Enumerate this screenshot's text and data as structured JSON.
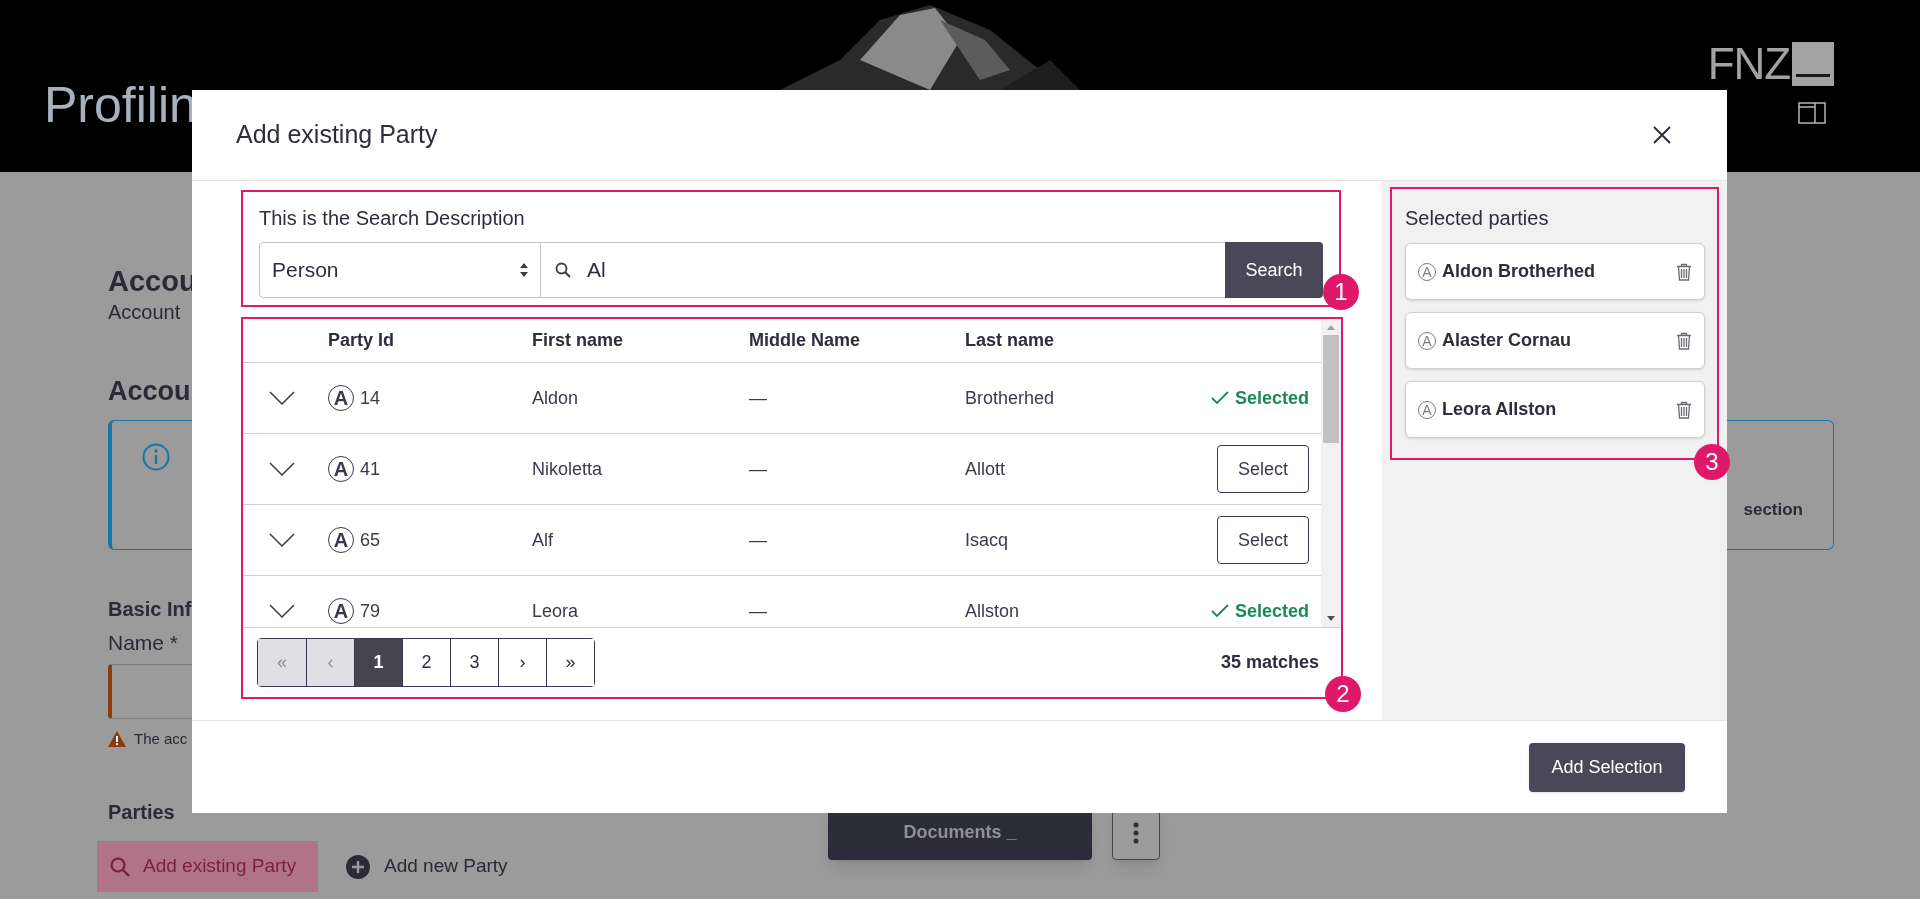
{
  "header": {
    "title": "Profilin",
    "logo": "FNZ"
  },
  "page": {
    "heading": "Accou",
    "subtitle": "Account",
    "section_heading": "Accou",
    "info_tail": "section",
    "basic_heading": "Basic Inf",
    "name_label": "Name *",
    "warning": "The acc",
    "parties_heading": "Parties",
    "add_existing": "Add existing Party",
    "add_new": "Add new Party",
    "documents_button": "Documents _"
  },
  "dialog": {
    "title": "Add existing Party",
    "search": {
      "description": "This is the Search Description",
      "type_value": "Person",
      "query": "Al",
      "button": "Search",
      "callout": "1"
    },
    "table": {
      "columns": [
        "Party Id",
        "First name",
        "Middle Name",
        "Last name"
      ],
      "rows": [
        {
          "type_icon": "A",
          "party_id": "14",
          "first_name": "Aldon",
          "middle_name": "—",
          "last_name": "Brotherhed",
          "selected": true,
          "action": "Selected"
        },
        {
          "type_icon": "A",
          "party_id": "41",
          "first_name": "Nikoletta",
          "middle_name": "—",
          "last_name": "Allott",
          "selected": false,
          "action": "Select"
        },
        {
          "type_icon": "A",
          "party_id": "65",
          "first_name": "Alf",
          "middle_name": "—",
          "last_name": "Isacq",
          "selected": false,
          "action": "Select"
        },
        {
          "type_icon": "A",
          "party_id": "79",
          "first_name": "Leora",
          "middle_name": "—",
          "last_name": "Allston",
          "selected": true,
          "action": "Selected"
        }
      ],
      "pagination": [
        {
          "label": "«",
          "disabled": true,
          "selected": false
        },
        {
          "label": "‹",
          "disabled": true,
          "selected": false
        },
        {
          "label": "1",
          "disabled": false,
          "selected": true
        },
        {
          "label": "2",
          "disabled": false,
          "selected": false
        },
        {
          "label": "3",
          "disabled": false,
          "selected": false
        },
        {
          "label": "›",
          "disabled": false,
          "selected": false
        },
        {
          "label": "»",
          "disabled": false,
          "selected": false
        }
      ],
      "matches": "35 matches",
      "callout": "2"
    },
    "selected_parties": {
      "title": "Selected parties",
      "callout": "3",
      "items": [
        {
          "type_icon": "A",
          "name": "Aldon Brotherhed"
        },
        {
          "type_icon": "A",
          "name": "Alaster Cornau"
        },
        {
          "type_icon": "A",
          "name": "Leora Allston"
        }
      ]
    },
    "add_button": "Add Selection"
  }
}
